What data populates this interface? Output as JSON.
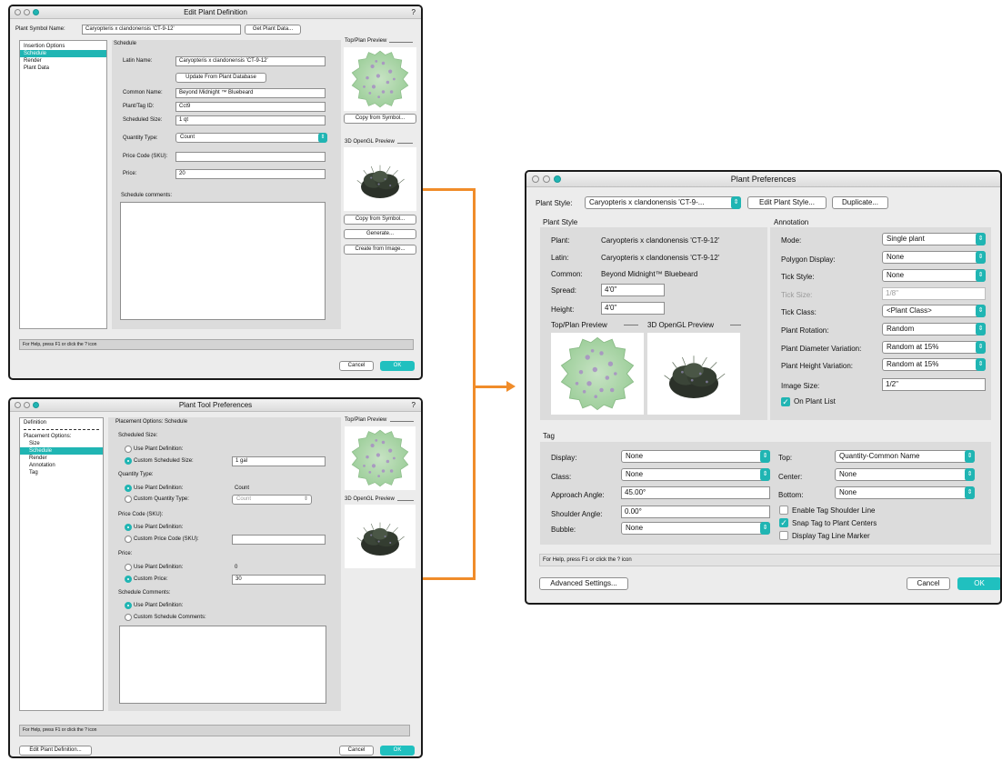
{
  "win1": {
    "title": "Edit Plant Definition",
    "help_glyph": "?",
    "symbol_label": "Plant Symbol Name:",
    "symbol_value": "Caryopteris x clandonensis 'CT-9-12'",
    "get_plant_data": "Get Plant Data...",
    "sidebar": [
      "Insertion Options",
      "Schedule",
      "Render",
      "Plant Data"
    ],
    "section": "Schedule",
    "latin_label": "Latin Name:",
    "latin_value": "Caryopteris x clandonensis 'CT-9-12'",
    "update_btn": "Update From Plant Database",
    "common_label": "Common Name:",
    "common_value": "Beyond Midnight ™ Bluebeard",
    "tag_label": "Plant/Tag ID:",
    "tag_value": "Cct9",
    "sched_label": "Scheduled Size:",
    "sched_value": "1 qt",
    "qty_label": "Quantity Type:",
    "qty_value": "Count",
    "price_code_label": "Price Code (SKU):",
    "price_label": "Price:",
    "price_value": "20",
    "comments_label": "Schedule comments:",
    "top_preview": "Top/Plan Preview",
    "gl_preview": "3D OpenGL Preview",
    "copy_symbol_1": "Copy from Symbol...",
    "copy_symbol_2": "Copy from Symbol...",
    "generate": "Generate...",
    "create_image": "Create from Image...",
    "help": "For Help, press F1 or click the ? icon",
    "cancel": "Cancel",
    "ok": "OK"
  },
  "win2": {
    "title": "Plant Tool Preferences",
    "help_glyph": "?",
    "sidebar": [
      "Definition",
      "Placement Options:",
      "Size",
      "Schedule",
      "Render",
      "Annotation",
      "Tag"
    ],
    "header": "Placement Options: Schedule",
    "sched_size": "Scheduled Size:",
    "use_def": "Use Plant Definition:",
    "custom_sched": "Custom Scheduled Size:",
    "custom_sched_value": "1 gal",
    "qty_type": "Quantity Type:",
    "use_def_2": "Use Plant Definition:",
    "use_def_2_value": "Count",
    "custom_qty": "Custom Quantity Type:",
    "custom_qty_value": "Count",
    "price_code": "Price Code (SKU):",
    "use_def_3": "Use Plant Definition:",
    "custom_price_code": "Custom Price Code (SKU):",
    "price": "Price:",
    "use_def_4": "Use Plant Definition:",
    "use_def_4_value": "0",
    "custom_price": "Custom Price:",
    "custom_price_value": "30",
    "sched_comments": "Schedule Comments:",
    "use_def_5": "Use Plant Definition:",
    "custom_comments": "Custom Schedule Comments:",
    "top_preview": "Top/Plan Preview",
    "gl_preview": "3D OpenGL Preview",
    "help": "For Help, press F1 or click the ? icon",
    "edit_def": "Edit Plant Definition...",
    "cancel": "Cancel",
    "ok": "OK"
  },
  "win3": {
    "title": "Plant Preferences",
    "style_label": "Plant Style:",
    "style_value": "Caryopteris x clandonensis 'CT-9-...",
    "edit_style": "Edit Plant Style...",
    "duplicate": "Duplicate...",
    "plant_style_section": "Plant Style",
    "plant_label": "Plant:",
    "plant_value": "Caryopteris x clandonensis 'CT-9-12'",
    "latin_label": "Latin:",
    "latin_value": "Caryopteris x clandonensis 'CT-9-12'",
    "common_label": "Common:",
    "common_value": "Beyond Midnight™ Bluebeard",
    "spread_label": "Spread:",
    "spread_value": "4'0\"",
    "height_label": "Height:",
    "height_value": "4'0\"",
    "top_preview": "Top/Plan Preview",
    "gl_preview": "3D OpenGL Preview",
    "annotation_section": "Annotation",
    "mode_label": "Mode:",
    "mode_value": "Single plant",
    "polygon_label": "Polygon Display:",
    "polygon_value": "None",
    "tick_style_label": "Tick Style:",
    "tick_style_value": "None",
    "tick_size_label": "Tick Size:",
    "tick_size_value": "1/8\"",
    "tick_class_label": "Tick Class:",
    "tick_class_value": "<Plant Class>",
    "rotation_label": "Plant Rotation:",
    "rotation_value": "Random",
    "diam_label": "Plant Diameter Variation:",
    "diam_value": "Random at 15%",
    "height_var_label": "Plant Height Variation:",
    "height_var_value": "Random at 15%",
    "image_size_label": "Image Size:",
    "image_size_value": "1/2\"",
    "on_plant_list": "On Plant List",
    "tag_section": "Tag",
    "display_label": "Display:",
    "display_value": "None",
    "class_label": "Class:",
    "class_value": "None",
    "approach_label": "Approach Angle:",
    "approach_value": "45.00°",
    "shoulder_label": "Shoulder Angle:",
    "shoulder_value": "0.00°",
    "bubble_label": "Bubble:",
    "bubble_value": "None",
    "top_label": "Top:",
    "top_value": "Quantity-Common Name",
    "center_label": "Center:",
    "center_value": "None",
    "bottom_label": "Bottom:",
    "bottom_value": "None",
    "enable_shoulder": "Enable Tag Shoulder Line",
    "snap_tag": "Snap Tag to Plant Centers",
    "display_marker": "Display Tag Line Marker",
    "help": "For Help, press F1 or click the ? icon",
    "advanced": "Advanced Settings...",
    "cancel": "Cancel",
    "ok": "OK"
  },
  "colors": {
    "accent": "#20b5b3",
    "connector": "#f08c2a"
  }
}
